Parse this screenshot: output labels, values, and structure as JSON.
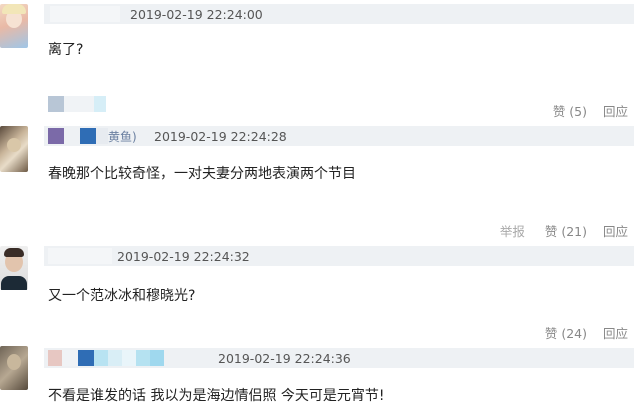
{
  "comments": [
    {
      "timestamp": "2019-02-19 22:24:00",
      "text": "离了?",
      "like_label": "赞 (5)",
      "reply_label": "回应",
      "avatar": "avatar-frozen-princess"
    },
    {
      "username_fragment": "黄鱼)",
      "timestamp": "2019-02-19 22:24:28",
      "text": "春晚那个比较奇怪，一对夫妻分两地表演两个节目",
      "report_label": "举报",
      "like_label": "赞 (21)",
      "reply_label": "回应",
      "avatar": "avatar-cat"
    },
    {
      "timestamp": "2019-02-19 22:24:32",
      "text": "又一个范冰冰和穆晓光?",
      "like_label": "赞 (24)",
      "reply_label": "回应",
      "avatar": "avatar-man-portrait"
    },
    {
      "timestamp": "2019-02-19 22:24:36",
      "text": "不看是谁发的话 我以为是海边情侣照 今天可是元宵节!",
      "avatar": "avatar-sepia-portrait"
    }
  ],
  "colors": {
    "header_bg": "#eef1f4",
    "action_text": "#888888",
    "mosaic_purple": "#7b6aa8",
    "mosaic_blue": "#2f6db5",
    "mosaic_cyan": "#9fd8ee"
  }
}
